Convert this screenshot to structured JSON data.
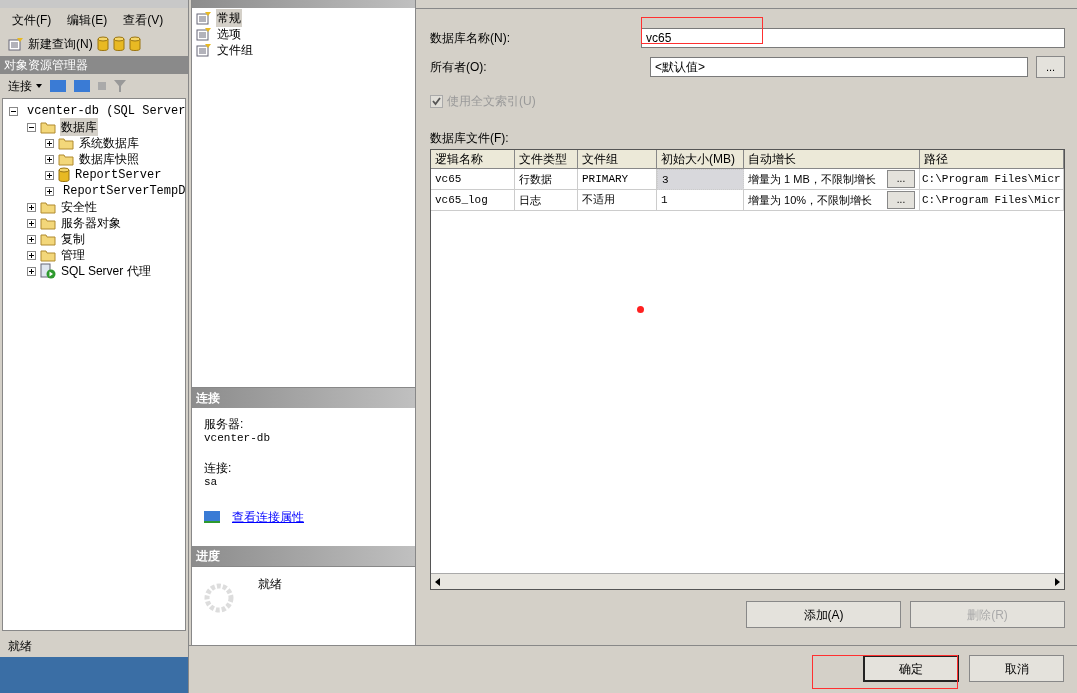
{
  "app_window": {
    "menu": [
      "文件(F)",
      "编辑(E)",
      "查看(V)"
    ],
    "toolbar": {
      "new_query": "新建查询(N)"
    }
  },
  "object_explorer": {
    "title": "对象资源管理器",
    "connect": "连接",
    "tree": [
      {
        "label": "vcenter-db (SQL Server",
        "kind": "server",
        "expanded": true,
        "selected": false,
        "children": [
          {
            "label": "数据库",
            "kind": "folder",
            "expanded": true,
            "selected": true,
            "children": [
              {
                "label": "系统数据库",
                "kind": "folder",
                "expanded": false,
                "selected": false
              },
              {
                "label": "数据库快照",
                "kind": "folder",
                "expanded": false,
                "selected": false
              },
              {
                "label": "ReportServer",
                "kind": "database",
                "expanded": false,
                "selected": false
              },
              {
                "label": "ReportServerTempD",
                "kind": "database",
                "expanded": false,
                "selected": false
              }
            ]
          },
          {
            "label": "安全性",
            "kind": "folder",
            "expanded": false,
            "selected": false
          },
          {
            "label": "服务器对象",
            "kind": "folder",
            "expanded": false,
            "selected": false
          },
          {
            "label": "复制",
            "kind": "folder",
            "expanded": false,
            "selected": false
          },
          {
            "label": "管理",
            "kind": "folder",
            "expanded": false,
            "selected": false
          },
          {
            "label": "SQL Server 代理",
            "kind": "agent",
            "expanded": false,
            "selected": false
          }
        ]
      }
    ],
    "status": "就绪"
  },
  "dialog": {
    "select_page": {
      "items": [
        {
          "label": "常规",
          "selected": true
        },
        {
          "label": "选项",
          "selected": false
        },
        {
          "label": "文件组",
          "selected": false
        }
      ]
    },
    "connection": {
      "title": "连接",
      "server_label": "服务器:",
      "server": "vcenter-db",
      "connection_label": "连接:",
      "connection": "sa",
      "link": "查看连接属性"
    },
    "progress": {
      "title": "进度",
      "status": "就绪"
    },
    "db_name": {
      "label": "数据库名称(N):",
      "value": "vc65"
    },
    "owner": {
      "label": "所有者(O):",
      "value": "<默认值>",
      "browse": "..."
    },
    "fulltext": {
      "label": "使用全文索引(U)",
      "checked": true,
      "disabled": true
    },
    "files": {
      "label": "数据库文件(F):",
      "columns": [
        "逻辑名称",
        "文件类型",
        "文件组",
        "初始大小(MB)",
        "自动增长",
        "路径"
      ],
      "rows": [
        {
          "cells": [
            "vc65",
            "行数据",
            "PRIMARY",
            "3",
            "增量为 1 MB，不限制增长",
            "C:\\Program Files\\Micr"
          ],
          "selected": true
        },
        {
          "cells": [
            "vc65_log",
            "日志",
            "不适用",
            "1",
            "增量为 10%，不限制增长",
            "C:\\Program Files\\Micr"
          ],
          "selected": false
        }
      ],
      "browse": "..."
    },
    "add": {
      "label": "添加(A)",
      "disabled": false
    },
    "remove": {
      "label": "删除(R)",
      "disabled": true
    },
    "ok": "确定",
    "cancel": "取消"
  }
}
